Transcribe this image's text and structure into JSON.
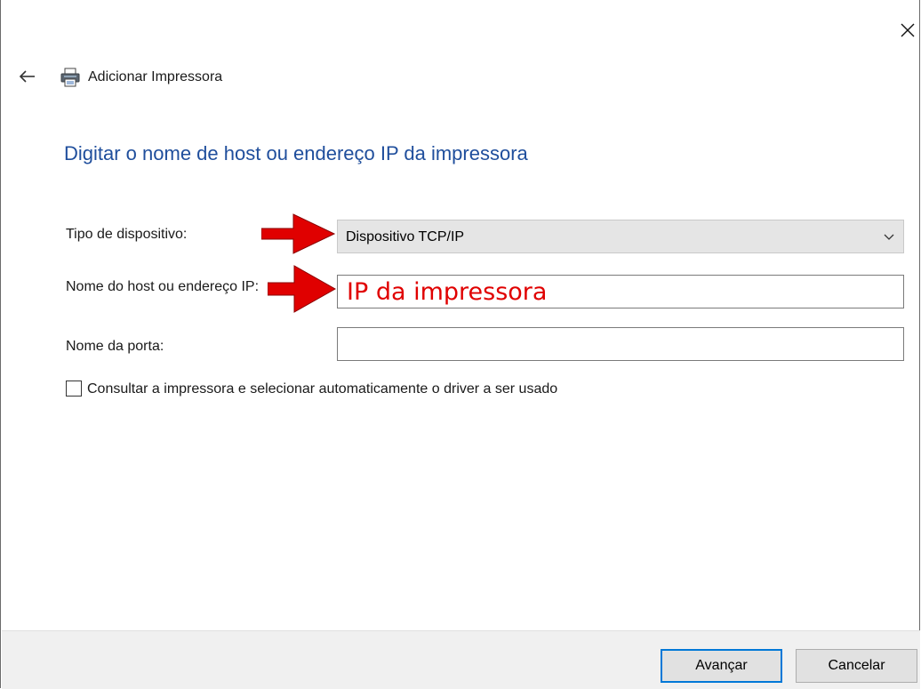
{
  "window": {
    "title": "Adicionar Impressora",
    "close_icon": "close-icon",
    "back_icon": "back-arrow-icon",
    "app_icon": "printer-icon"
  },
  "page": {
    "heading": "Digitar o nome de host ou endereço IP da impressora"
  },
  "form": {
    "device_type": {
      "label": "Tipo de dispositivo:",
      "selected": "Dispositivo TCP/IP",
      "chevron_icon": "chevron-down-icon"
    },
    "host": {
      "label": "Nome do host ou endereço IP:",
      "value": "",
      "annotation": "IP da impressora"
    },
    "port": {
      "label": "Nome da porta:",
      "value": ""
    },
    "auto_driver": {
      "label": "Consultar a impressora e selecionar automaticamente o driver a ser usado",
      "checked": false
    }
  },
  "annotations": {
    "arrow_icon": "red-arrow-icon",
    "color": "#e00000"
  },
  "footer": {
    "next_label": "Avançar",
    "cancel_label": "Cancelar"
  },
  "colors": {
    "heading": "#1f4e9c",
    "primary_border": "#0078d7",
    "footer_bg": "#f0f0f0"
  }
}
